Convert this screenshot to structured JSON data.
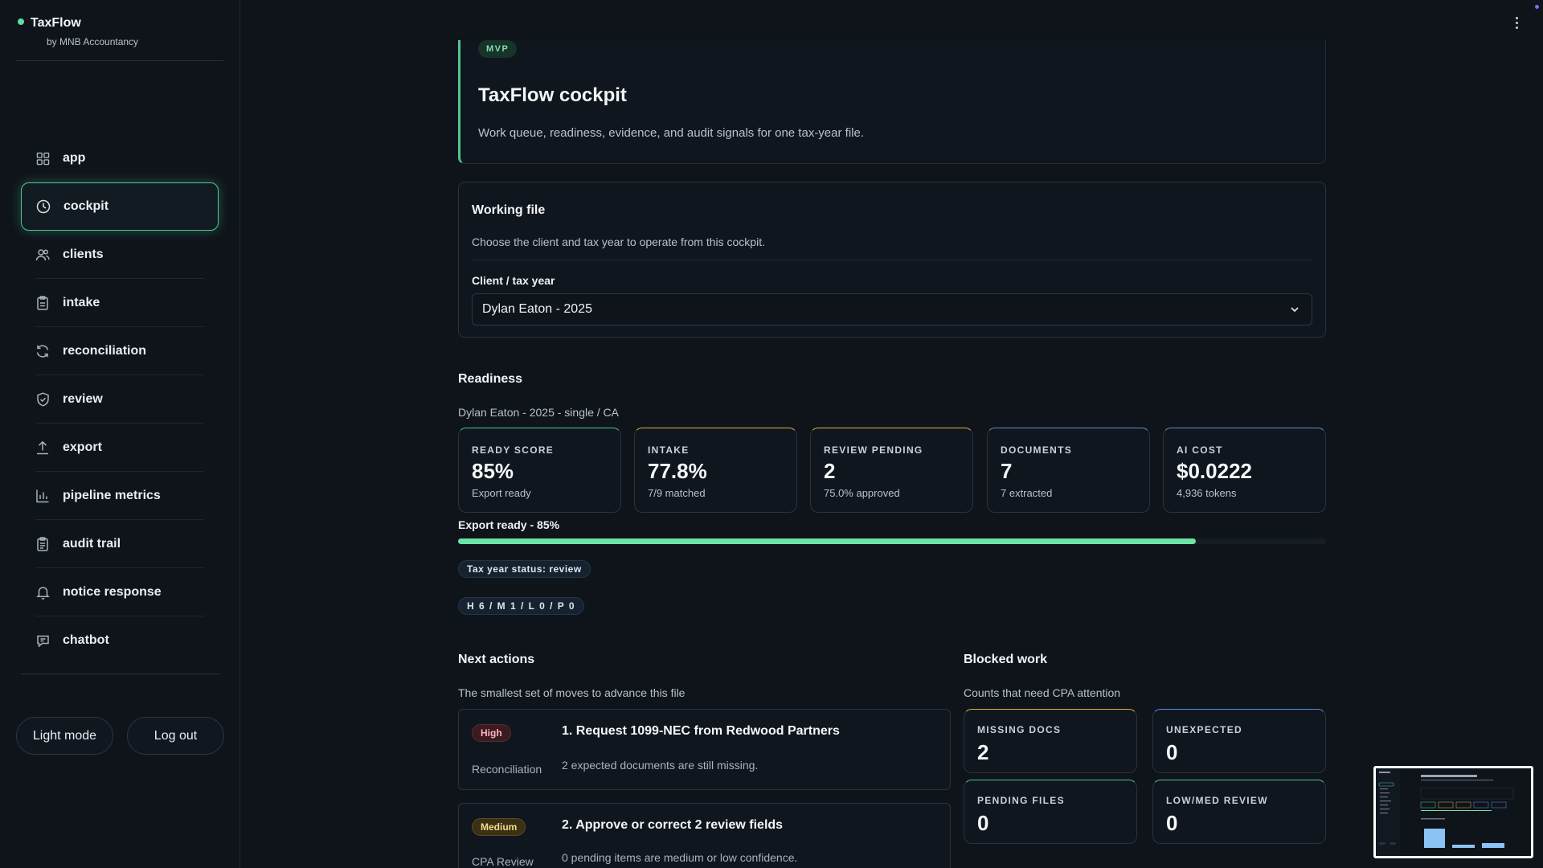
{
  "brand": {
    "name": "TaxFlow",
    "subtitle": "by MNB Accountancy",
    "accent": "#5ee0a0"
  },
  "sidebar": {
    "items": [
      {
        "label": "app",
        "icon": "grid-icon"
      },
      {
        "label": "cockpit",
        "icon": "clock-icon",
        "active": true
      },
      {
        "label": "clients",
        "icon": "users-icon"
      },
      {
        "label": "intake",
        "icon": "clipboard-icon"
      },
      {
        "label": "reconciliation",
        "icon": "refresh-icon"
      },
      {
        "label": "review",
        "icon": "shield-icon"
      },
      {
        "label": "export",
        "icon": "upload-icon"
      },
      {
        "label": "pipeline metrics",
        "icon": "bar-chart-icon"
      },
      {
        "label": "audit trail",
        "icon": "clipboard-list-icon"
      },
      {
        "label": "notice response",
        "icon": "bell-icon"
      },
      {
        "label": "chatbot",
        "icon": "chat-icon"
      }
    ],
    "light_mode_label": "Light mode",
    "logout_label": "Log out"
  },
  "hero": {
    "badge": "MVP",
    "title": "TaxFlow cockpit",
    "subtitle": "Work queue, readiness, evidence, and audit signals for one tax-year file."
  },
  "working_file": {
    "title": "Working file",
    "subtitle": "Choose the client and tax year to operate from this cockpit.",
    "select_label": "Client / tax year",
    "selected": "Dylan Eaton - 2025"
  },
  "readiness": {
    "title": "Readiness",
    "subtitle": "Dylan Eaton - 2025 - single / CA",
    "stats": [
      {
        "label": "READY SCORE",
        "value": "85%",
        "note": "Export ready",
        "accent": "#4ec890"
      },
      {
        "label": "INTAKE",
        "value": "77.8%",
        "note": "7/9 matched",
        "accent": "#e0b04a"
      },
      {
        "label": "REVIEW PENDING",
        "value": "2",
        "note": "75.0% approved",
        "accent": "#e0b04a"
      },
      {
        "label": "DOCUMENTS",
        "value": "7",
        "note": "7 extracted",
        "accent": "#5a8fd8"
      },
      {
        "label": "AI COST",
        "value": "$0.0222",
        "note": "4,936 tokens",
        "accent": "#5a8fd8"
      }
    ],
    "progress_label": "Export ready - 85%",
    "progress_fraction": 0.85,
    "status_chip": "Tax year status: review",
    "counts_chip": "H 6 / M 1 / L 0 / P 0"
  },
  "next_actions": {
    "title": "Next actions",
    "subtitle": "The smallest set of moves to advance this file",
    "items": [
      {
        "priority": "High",
        "category": "Reconciliation",
        "title": "1. Request 1099-NEC from Redwood Partners",
        "description": "2 expected documents are still missing."
      },
      {
        "priority": "Medium",
        "category": "CPA Review",
        "title": "2. Approve or correct 2 review fields",
        "description": "0 pending items are medium or low confidence."
      }
    ]
  },
  "blocked_work": {
    "title": "Blocked work",
    "subtitle": "Counts that need CPA attention",
    "items": [
      {
        "label": "MISSING DOCS",
        "value": "2",
        "accent": "#e0b04a"
      },
      {
        "label": "UNEXPECTED",
        "value": "0",
        "accent": "#5a8fd8"
      },
      {
        "label": "PENDING FILES",
        "value": "0",
        "accent": "#4ec890"
      },
      {
        "label": "LOW/MED REVIEW",
        "value": "0",
        "accent": "#4ec890"
      }
    ]
  }
}
